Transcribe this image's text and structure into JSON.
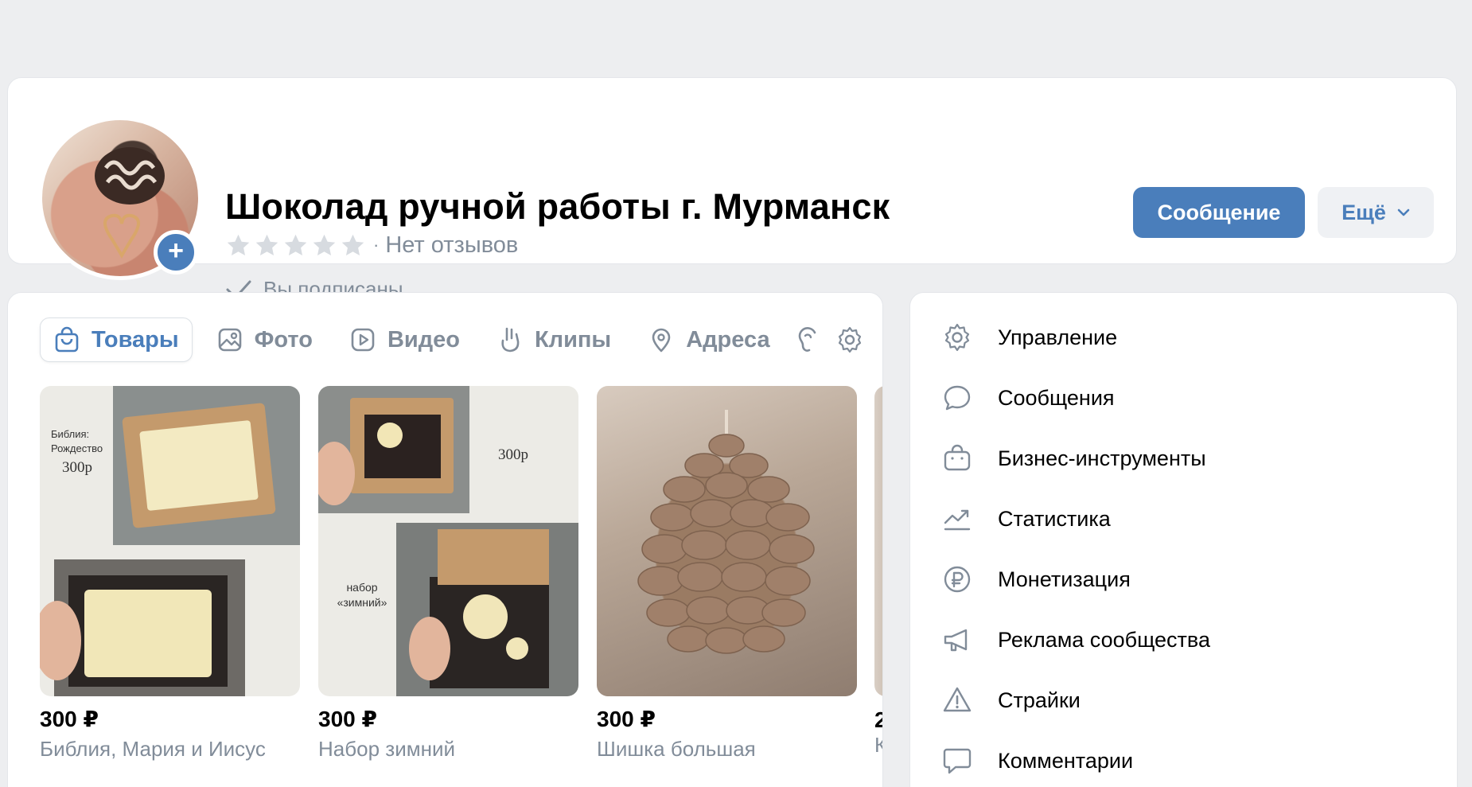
{
  "header": {
    "title": "Шоколад ручной работы г. Мурманск",
    "rating_stars": 5,
    "rating_dot": "·",
    "reviews": "Нет отзывов",
    "subscribed": "Вы подписаны",
    "message_button": "Сообщение",
    "more_button": "Ещё",
    "avatar_add": "+"
  },
  "tabs": [
    {
      "label": "Товары",
      "icon": "bag-icon",
      "active": true
    },
    {
      "label": "Фото",
      "icon": "photo-icon",
      "active": false
    },
    {
      "label": "Видео",
      "icon": "video-icon",
      "active": false
    },
    {
      "label": "Клипы",
      "icon": "clips-icon",
      "active": false
    },
    {
      "label": "Адреса",
      "icon": "location-icon",
      "active": false
    }
  ],
  "products": [
    {
      "price": "300 ₽",
      "name": "Библия, Мария и Иисус",
      "image_caption_1": "Библия:",
      "image_caption_2": "Рождество",
      "image_caption_3": "300р"
    },
    {
      "price": "300 ₽",
      "name": "Набор зимний",
      "image_caption_1": "300р",
      "image_caption_2": "набор",
      "image_caption_3": "«зимний»"
    },
    {
      "price": "300 ₽",
      "name": "Шишка большая"
    }
  ],
  "peek_product": {
    "price": "2",
    "name": "К"
  },
  "management": [
    {
      "label": "Управление",
      "icon": "gear-icon"
    },
    {
      "label": "Сообщения",
      "icon": "message-icon"
    },
    {
      "label": "Бизнес-инструменты",
      "icon": "briefcase-icon"
    },
    {
      "label": "Статистика",
      "icon": "stats-icon"
    },
    {
      "label": "Монетизация",
      "icon": "ruble-icon"
    },
    {
      "label": "Реклама сообщества",
      "icon": "megaphone-icon"
    },
    {
      "label": "Страйки",
      "icon": "warning-icon"
    },
    {
      "label": "Комментарии",
      "icon": "comment-icon"
    }
  ],
  "colors": {
    "accent": "#4a7ebb",
    "secondary_text": "#818c99",
    "background": "#edeef0"
  }
}
